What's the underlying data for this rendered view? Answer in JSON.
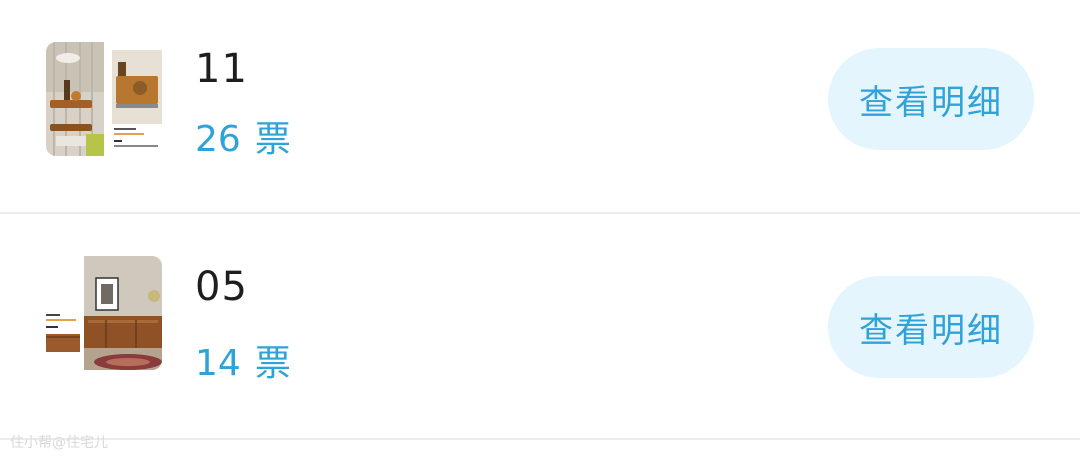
{
  "items": [
    {
      "title": "11",
      "vote_count": "26",
      "vote_unit": "票",
      "detail_label": "查看明细",
      "thumbnail_icon": "bar-cart-product-image"
    },
    {
      "title": "05",
      "vote_count": "14",
      "vote_unit": "票",
      "detail_label": "查看明细",
      "thumbnail_icon": "tv-cabinet-product-image"
    }
  ],
  "watermark": "住小帮@住宅儿",
  "colors": {
    "accent": "#2fa3d8",
    "button_bg": "#e4f5fd",
    "title": "#1e1e1e",
    "divider": "#ececec"
  }
}
